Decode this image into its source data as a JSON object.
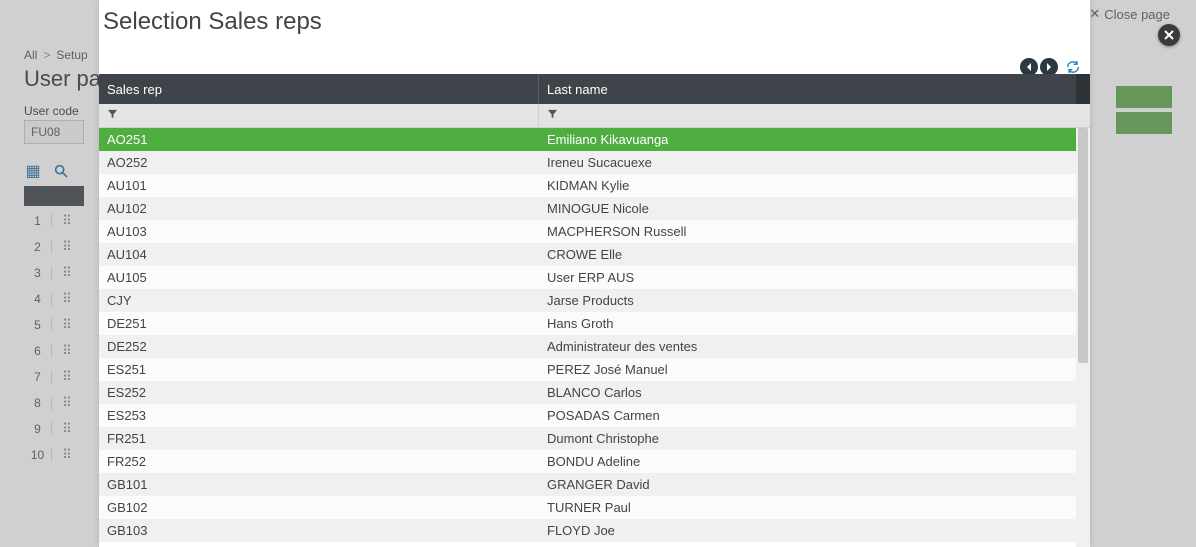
{
  "background": {
    "breadcrumb": {
      "root": "All",
      "node": "Setup"
    },
    "page_title_visible": "User pa",
    "user_code_label": "User code",
    "user_code_value": "FU08",
    "close_page_label": "Close page",
    "row_numbers": [
      "1",
      "2",
      "3",
      "4",
      "5",
      "6",
      "7",
      "8",
      "9",
      "10"
    ]
  },
  "modal": {
    "title": "Selection Sales reps",
    "columns": {
      "a": "Sales rep",
      "b": "Last name"
    },
    "rows": [
      {
        "code": "AO251",
        "name": "Emiliano Kikavuanga",
        "selected": true
      },
      {
        "code": "AO252",
        "name": "Ireneu Sucacuexe"
      },
      {
        "code": "AU101",
        "name": "KIDMAN Kylie"
      },
      {
        "code": "AU102",
        "name": "MINOGUE Nicole"
      },
      {
        "code": "AU103",
        "name": "MACPHERSON Russell"
      },
      {
        "code": "AU104",
        "name": "CROWE Elle"
      },
      {
        "code": "AU105",
        "name": "User ERP AUS"
      },
      {
        "code": "CJY",
        "name": "Jarse Products"
      },
      {
        "code": "DE251",
        "name": "Hans Groth"
      },
      {
        "code": "DE252",
        "name": "Administrateur des ventes"
      },
      {
        "code": "ES251",
        "name": "PEREZ José Manuel"
      },
      {
        "code": "ES252",
        "name": "BLANCO Carlos"
      },
      {
        "code": "ES253",
        "name": "POSADAS Carmen"
      },
      {
        "code": "FR251",
        "name": "Dumont Christophe"
      },
      {
        "code": "FR252",
        "name": "BONDU Adeline"
      },
      {
        "code": "GB101",
        "name": "GRANGER David"
      },
      {
        "code": "GB102",
        "name": "TURNER Paul"
      },
      {
        "code": "GB103",
        "name": "FLOYD Joe"
      }
    ]
  }
}
